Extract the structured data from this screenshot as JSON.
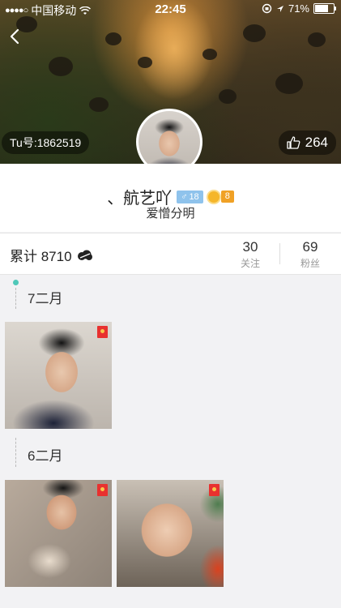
{
  "status_bar": {
    "signal_dots": "●●●●○",
    "carrier": "中国移动",
    "time": "22:45",
    "battery_percent": "71%",
    "battery_level": 0.71
  },
  "header": {
    "tu_id": "Tu号:1862519",
    "likes": "264"
  },
  "profile": {
    "name": "、航艺吖",
    "gender_symbol": "♂",
    "age": "18",
    "level": "8",
    "signature": "爱憎分明"
  },
  "stats": {
    "total_label": "累计 8710",
    "following_count": "30",
    "following_label": "关注",
    "fans_count": "69",
    "fans_label": "粉丝"
  },
  "timeline": [
    {
      "date": "7二月",
      "photos": 1
    },
    {
      "date": "6二月",
      "photos": 2
    }
  ],
  "colors": {
    "accent_teal": "#4fc8b8",
    "gender_badge": "#8fc3ec",
    "level_badge": "#f0a125",
    "flag_red": "#e8312f"
  }
}
